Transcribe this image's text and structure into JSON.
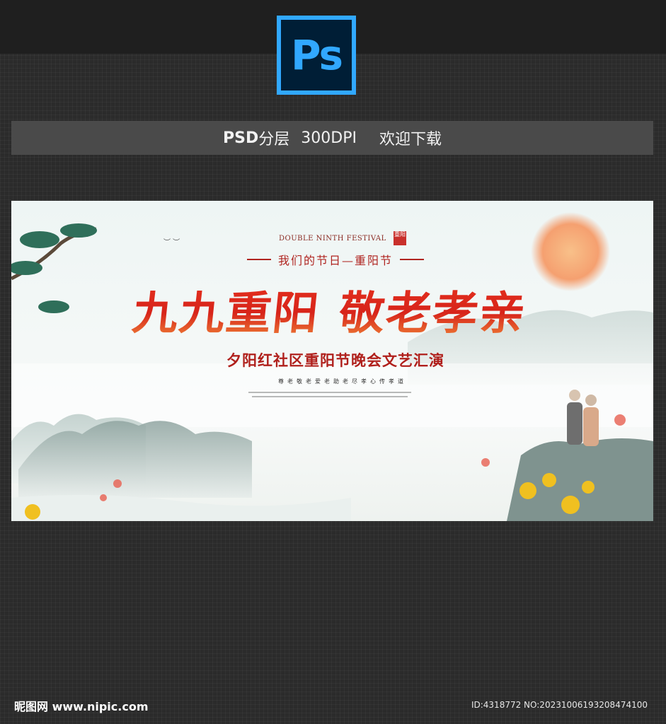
{
  "app_logo": {
    "text": "Ps",
    "color": "#31a8ff",
    "bg": "#001e36"
  },
  "info_bar": {
    "psd": "PSD",
    "layers": "分层",
    "dpi": "300DPI",
    "download": "欢迎下载"
  },
  "banner": {
    "en_title": "DOUBLE NINTH FESTIVAL",
    "seal_text": "重阳",
    "subheading": "我们的节日—重阳节",
    "title_part1": "九九重阳",
    "title_part2": "敬老孝亲",
    "event_title": "夕阳红社区重阳节晚会文艺汇演",
    "slogan": "尊老敬老爱老助老尽孝心传孝道",
    "colors": {
      "title_red": "#d7241a",
      "accent_red": "#b02420",
      "sun": "#f5a070"
    }
  },
  "footer": {
    "site": "昵图网 www.nipic.com",
    "id": "ID:4318772 NO:20231006193208474100"
  }
}
